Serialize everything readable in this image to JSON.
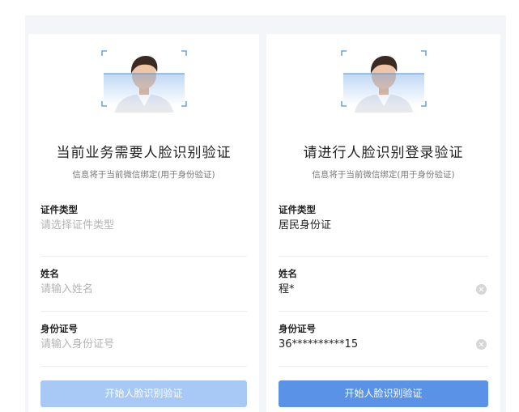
{
  "colors": {
    "background": "#f4f5f9",
    "card": "#ffffff",
    "button_disabled": "#a8c9f5",
    "button_active": "#5a92e8",
    "scan_frame": "#4a90e2",
    "placeholder": "#b3b3b3"
  },
  "left_card": {
    "title": "当前业务需要人脸识别验证",
    "subtitle": "信息将于当前微信绑定(用于身份验证)",
    "fields": [
      {
        "label": "证件类型",
        "placeholder": "请选择证件类型"
      },
      {
        "label": "姓名",
        "placeholder": "请输入姓名"
      },
      {
        "label": "身份证号",
        "placeholder": "请输入身份证号"
      }
    ],
    "button_label": "开始人脸识别验证",
    "button_state": "disabled"
  },
  "right_card": {
    "title": "请进行人脸识别登录验证",
    "subtitle": "信息将于当前微信绑定(用于身份验证)",
    "fields": [
      {
        "label": "证件类型",
        "value": "居民身份证"
      },
      {
        "label": "姓名",
        "value": "程*"
      },
      {
        "label": "身份证号",
        "value": "36**********15"
      }
    ],
    "button_label": "开始人脸识别验证",
    "button_state": "enabled"
  },
  "icons": [
    "face-scan-icon",
    "clear-icon"
  ]
}
